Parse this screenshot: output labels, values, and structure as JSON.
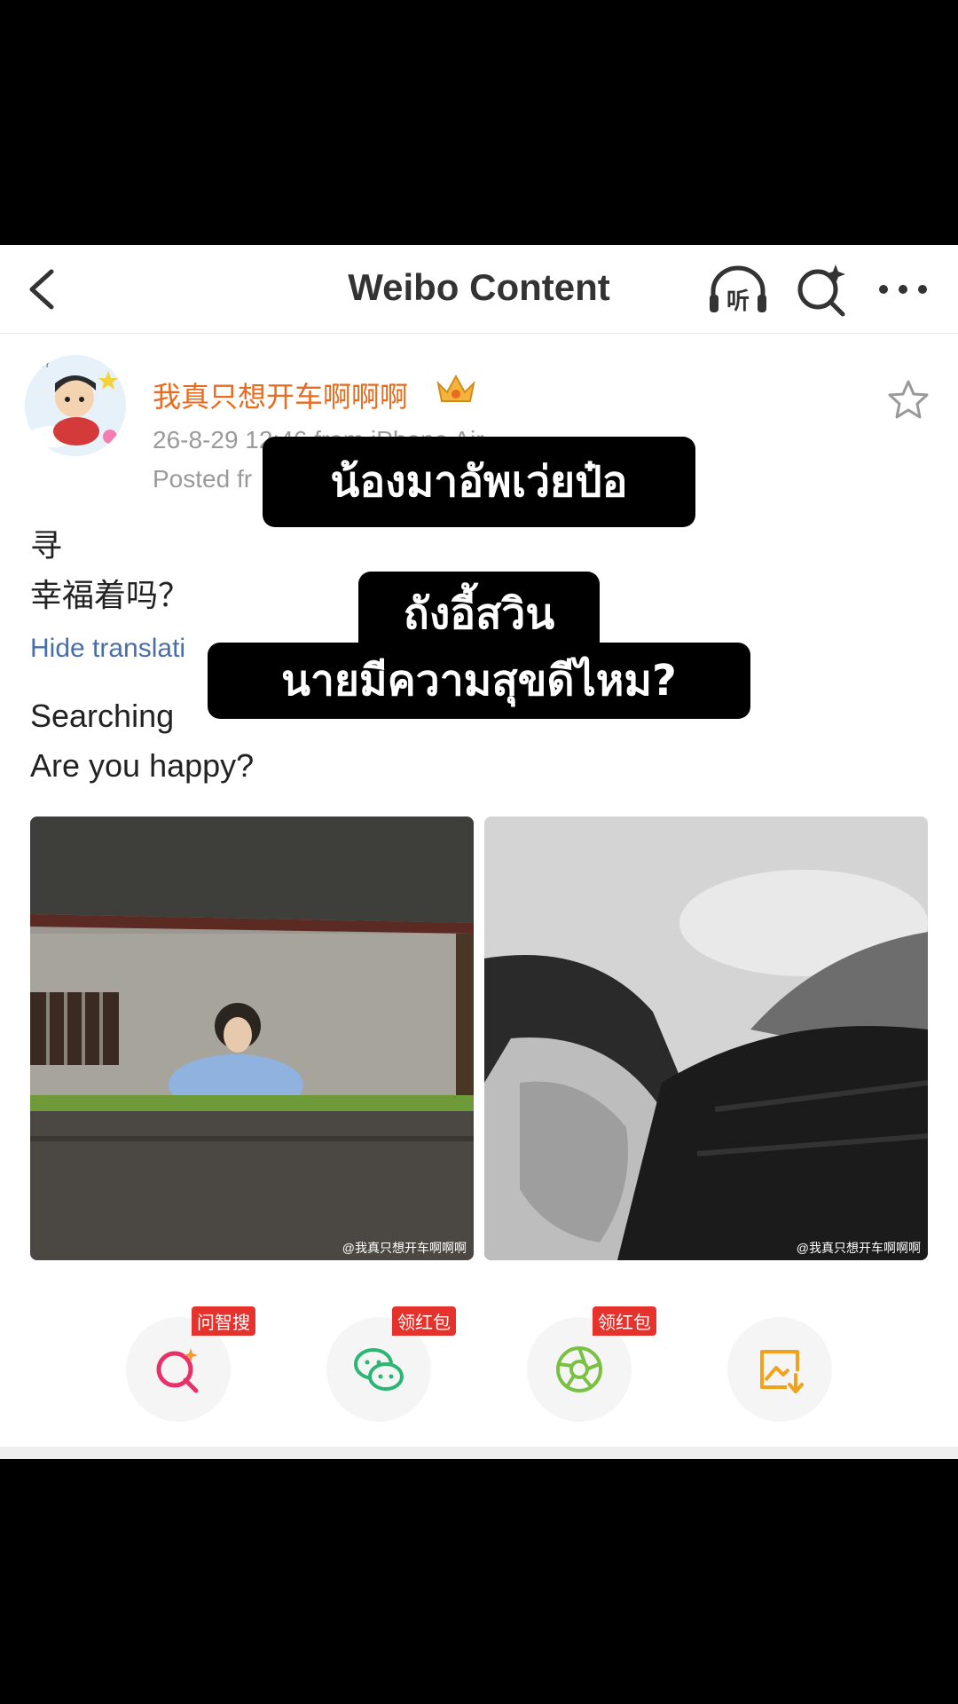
{
  "nav": {
    "title": "Weibo Content",
    "listen_label": "听"
  },
  "post": {
    "username": "我真只想开车啊啊啊",
    "time_source": "26-8-29 12:46  from iPhone Air",
    "posted_from": "Posted fr",
    "text_line1": "寻",
    "text_line2": "幸福着吗？",
    "hide_translation": "Hide translati",
    "translation_line1": "Searching",
    "translation_line2": "Are you happy?"
  },
  "captions": {
    "line1": "น้องมาอัพเว่ยป๋อ",
    "line2": "ถังอี้สวิน",
    "line3": "นายมีความสุขดีไหม?"
  },
  "photos": {
    "watermark1": "@我真只想开车啊啊啊",
    "watermark2": "@我真只想开车啊啊啊"
  },
  "actions": [
    {
      "badge": "问智搜",
      "icon": "ai-search-icon"
    },
    {
      "badge": "领红包",
      "icon": "wechat-icon"
    },
    {
      "badge": "领红包",
      "icon": "moments-icon"
    },
    {
      "badge": "",
      "icon": "save-image-icon"
    }
  ],
  "colors": {
    "username": "#e86b1f",
    "link": "#4a6ea8",
    "badge": "#e5322c"
  }
}
